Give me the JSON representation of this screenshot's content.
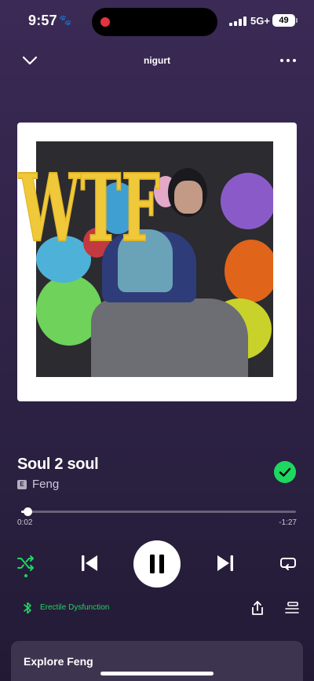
{
  "status_bar": {
    "time": "9:57",
    "network": "5G+",
    "battery": "49",
    "paw_icon": "paw-icon"
  },
  "header": {
    "context_title": "nigurt",
    "collapse_icon": "chevron-down-icon",
    "more_icon": "more-options-icon"
  },
  "artwork": {
    "overlay_text": "WTF"
  },
  "track": {
    "title": "Soul 2 soul",
    "explicit_badge": "E",
    "artist": "Feng",
    "liked": true
  },
  "playback": {
    "elapsed": "0:02",
    "remaining": "-1:27",
    "progress_fraction": 0.022,
    "shuffle_enabled": true,
    "is_playing": true
  },
  "device": {
    "name": "Erectile Dysfunction",
    "icon": "bluetooth-icon"
  },
  "explore": {
    "title": "Explore Feng"
  },
  "colors": {
    "accent_green": "#1ed760",
    "background": "#33254c"
  }
}
